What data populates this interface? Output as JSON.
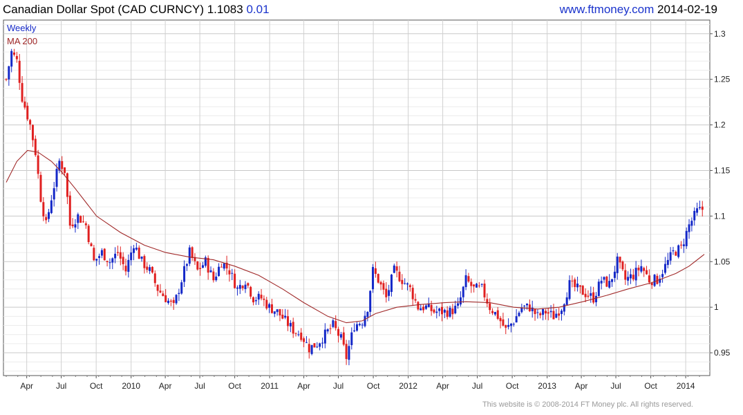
{
  "header": {
    "title": "Canadian Dollar Spot (CAD CURNCY) 1.1083",
    "change": "0.01",
    "site": "www.ftmoney.com",
    "date": "2014-02-19"
  },
  "footer": {
    "copyright": "This website is © 2008-2014 FT Money plc. All rights reserved."
  },
  "chart_data": {
    "type": "candlestick-line",
    "title": "Canadian Dollar Spot (CAD CURNCY) 1.1083",
    "legend": [
      "Weekly",
      "MA 200"
    ],
    "legend_placement": "top-left",
    "grid": true,
    "y_axis_side": "right",
    "ylim": [
      0.925,
      1.315
    ],
    "y_ticks": [
      0.95,
      1,
      1.05,
      1.1,
      1.15,
      1.2,
      1.25,
      1.3
    ],
    "y_tick_labels": [
      "0.95",
      "1",
      "1.05",
      "1.1",
      "1.15",
      "1.2",
      "1.25",
      "1.3"
    ],
    "x_range": [
      "2009-02-06",
      "2014-02-19"
    ],
    "x_ticks": [
      {
        "date": "2009-04-01",
        "label": "Apr"
      },
      {
        "date": "2009-07-01",
        "label": "Jul"
      },
      {
        "date": "2009-10-01",
        "label": "Oct"
      },
      {
        "date": "2010-01-01",
        "label": "2010"
      },
      {
        "date": "2010-04-01",
        "label": "Apr"
      },
      {
        "date": "2010-07-01",
        "label": "Jul"
      },
      {
        "date": "2010-10-01",
        "label": "Oct"
      },
      {
        "date": "2011-01-01",
        "label": "2011"
      },
      {
        "date": "2011-04-01",
        "label": "Apr"
      },
      {
        "date": "2011-07-01",
        "label": "Jul"
      },
      {
        "date": "2011-10-01",
        "label": "Oct"
      },
      {
        "date": "2012-01-01",
        "label": "2012"
      },
      {
        "date": "2012-04-01",
        "label": "Apr"
      },
      {
        "date": "2012-07-01",
        "label": "Jul"
      },
      {
        "date": "2012-10-01",
        "label": "Oct"
      },
      {
        "date": "2013-01-01",
        "label": "2013"
      },
      {
        "date": "2013-04-01",
        "label": "Apr"
      },
      {
        "date": "2013-07-01",
        "label": "Jul"
      },
      {
        "date": "2013-10-01",
        "label": "Oct"
      },
      {
        "date": "2014-01-01",
        "label": "2014"
      }
    ],
    "price_path": [
      [
        "2009-02-06",
        1.25
      ],
      [
        "2009-02-20",
        1.28
      ],
      [
        "2009-03-06",
        1.27
      ],
      [
        "2009-03-20",
        1.23
      ],
      [
        "2009-04-10",
        1.2
      ],
      [
        "2009-04-24",
        1.17
      ],
      [
        "2009-05-08",
        1.12
      ],
      [
        "2009-05-22",
        1.09
      ],
      [
        "2009-06-05",
        1.12
      ],
      [
        "2009-06-26",
        1.16
      ],
      [
        "2009-07-10",
        1.15
      ],
      [
        "2009-07-24",
        1.09
      ],
      [
        "2009-08-14",
        1.1
      ],
      [
        "2009-09-04",
        1.09
      ],
      [
        "2009-09-25",
        1.05
      ],
      [
        "2009-10-16",
        1.06
      ],
      [
        "2009-11-06",
        1.05
      ],
      [
        "2009-11-27",
        1.06
      ],
      [
        "2009-12-18",
        1.04
      ],
      [
        "2010-01-08",
        1.07
      ],
      [
        "2010-01-29",
        1.05
      ],
      [
        "2010-02-19",
        1.04
      ],
      [
        "2010-03-12",
        1.02
      ],
      [
        "2010-04-02",
        1.01
      ],
      [
        "2010-04-23",
        1.0
      ],
      [
        "2010-05-14",
        1.03
      ],
      [
        "2010-06-04",
        1.06
      ],
      [
        "2010-06-25",
        1.04
      ],
      [
        "2010-07-16",
        1.05
      ],
      [
        "2010-08-06",
        1.03
      ],
      [
        "2010-08-27",
        1.05
      ],
      [
        "2010-09-17",
        1.04
      ],
      [
        "2010-10-08",
        1.02
      ],
      [
        "2010-10-29",
        1.03
      ],
      [
        "2010-11-19",
        1.01
      ],
      [
        "2010-12-10",
        1.01
      ],
      [
        "2010-12-31",
        1.0
      ],
      [
        "2011-01-21",
        0.995
      ],
      [
        "2011-02-11",
        0.985
      ],
      [
        "2011-03-04",
        0.975
      ],
      [
        "2011-03-25",
        0.97
      ],
      [
        "2011-04-15",
        0.955
      ],
      [
        "2011-05-06",
        0.96
      ],
      [
        "2011-05-27",
        0.97
      ],
      [
        "2011-06-17",
        0.98
      ],
      [
        "2011-07-08",
        0.965
      ],
      [
        "2011-07-22",
        0.945
      ],
      [
        "2011-08-12",
        0.98
      ],
      [
        "2011-09-02",
        0.985
      ],
      [
        "2011-09-16",
        1.0
      ],
      [
        "2011-09-30",
        1.04
      ],
      [
        "2011-10-14",
        1.03
      ],
      [
        "2011-11-04",
        1.01
      ],
      [
        "2011-11-25",
        1.04
      ],
      [
        "2011-12-16",
        1.03
      ],
      [
        "2012-01-06",
        1.02
      ],
      [
        "2012-01-27",
        1.0
      ],
      [
        "2012-02-17",
        1.0
      ],
      [
        "2012-03-09",
        0.995
      ],
      [
        "2012-03-30",
        0.995
      ],
      [
        "2012-04-20",
        0.995
      ],
      [
        "2012-05-11",
        1.0
      ],
      [
        "2012-06-01",
        1.03
      ],
      [
        "2012-06-22",
        1.02
      ],
      [
        "2012-07-13",
        1.02
      ],
      [
        "2012-08-03",
        1.0
      ],
      [
        "2012-08-24",
        0.99
      ],
      [
        "2012-09-14",
        0.975
      ],
      [
        "2012-10-05",
        0.985
      ],
      [
        "2012-10-26",
        1.0
      ],
      [
        "2012-11-16",
        1.0
      ],
      [
        "2012-12-07",
        0.99
      ],
      [
        "2012-12-28",
        0.995
      ],
      [
        "2013-01-18",
        0.99
      ],
      [
        "2013-02-08",
        1.0
      ],
      [
        "2013-03-01",
        1.025
      ],
      [
        "2013-03-22",
        1.02
      ],
      [
        "2013-04-12",
        1.015
      ],
      [
        "2013-05-03",
        1.01
      ],
      [
        "2013-05-24",
        1.03
      ],
      [
        "2013-06-14",
        1.025
      ],
      [
        "2013-07-05",
        1.05
      ],
      [
        "2013-07-26",
        1.03
      ],
      [
        "2013-08-16",
        1.035
      ],
      [
        "2013-09-06",
        1.045
      ],
      [
        "2013-09-27",
        1.03
      ],
      [
        "2013-10-18",
        1.03
      ],
      [
        "2013-11-08",
        1.045
      ],
      [
        "2013-11-29",
        1.06
      ],
      [
        "2013-12-20",
        1.065
      ],
      [
        "2014-01-10",
        1.09
      ],
      [
        "2014-01-31",
        1.105
      ],
      [
        "2014-02-19",
        1.1083
      ]
    ],
    "ma200_path": [
      [
        "2009-02-06",
        1.137
      ],
      [
        "2009-03-06",
        1.16
      ],
      [
        "2009-04-03",
        1.172
      ],
      [
        "2009-05-01",
        1.17
      ],
      [
        "2009-06-05",
        1.16
      ],
      [
        "2009-07-03",
        1.148
      ],
      [
        "2009-08-07",
        1.13
      ],
      [
        "2009-10-02",
        1.1
      ],
      [
        "2009-12-04",
        1.082
      ],
      [
        "2010-02-05",
        1.068
      ],
      [
        "2010-04-02",
        1.06
      ],
      [
        "2010-06-04",
        1.055
      ],
      [
        "2010-08-06",
        1.052
      ],
      [
        "2010-10-01",
        1.045
      ],
      [
        "2010-12-03",
        1.035
      ],
      [
        "2011-02-04",
        1.02
      ],
      [
        "2011-04-01",
        1.005
      ],
      [
        "2011-06-03",
        0.99
      ],
      [
        "2011-07-22",
        0.983
      ],
      [
        "2011-09-02",
        0.985
      ],
      [
        "2011-10-07",
        0.993
      ],
      [
        "2011-12-02",
        1.0
      ],
      [
        "2012-02-03",
        1.003
      ],
      [
        "2012-04-06",
        1.005
      ],
      [
        "2012-06-01",
        1.006
      ],
      [
        "2012-08-03",
        1.005
      ],
      [
        "2012-10-05",
        1.0
      ],
      [
        "2012-12-07",
        0.998
      ],
      [
        "2013-02-01",
        1.0
      ],
      [
        "2013-04-05",
        1.006
      ],
      [
        "2013-06-07",
        1.013
      ],
      [
        "2013-08-02",
        1.02
      ],
      [
        "2013-10-04",
        1.027
      ],
      [
        "2013-12-06",
        1.037
      ],
      [
        "2014-01-10",
        1.045
      ],
      [
        "2014-02-19",
        1.058
      ]
    ],
    "colors": {
      "up": "#1428c8",
      "down": "#e02020",
      "ma": "#a02828",
      "grid": "#d0d0d0",
      "legend_weekly": "#1428c8",
      "legend_ma": "#a02828"
    }
  }
}
